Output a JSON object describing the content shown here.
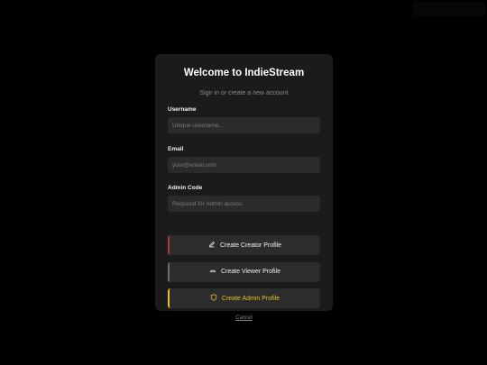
{
  "modal": {
    "title": "Welcome to IndieStream",
    "subtitle": "Sign in or create a new account",
    "fields": {
      "username": {
        "label": "Username",
        "placeholder": "Unique username..."
      },
      "email": {
        "label": "Email",
        "placeholder": "your@email.com"
      },
      "admin_code": {
        "label": "Admin Code",
        "placeholder": "Required for Admin access"
      }
    },
    "buttons": {
      "creator": "Create Creator Profile",
      "viewer": "Create Viewer Profile",
      "admin": "Create Admin Profile"
    },
    "cancel_label": "Cancel"
  },
  "colors": {
    "creator_accent": "#b03a3a",
    "viewer_accent": "#6e6e6e",
    "admin_accent": "#e5c21f"
  },
  "icons": {
    "creator": "pencil-icon",
    "viewer": "eye-icon",
    "admin": "shield-icon"
  }
}
